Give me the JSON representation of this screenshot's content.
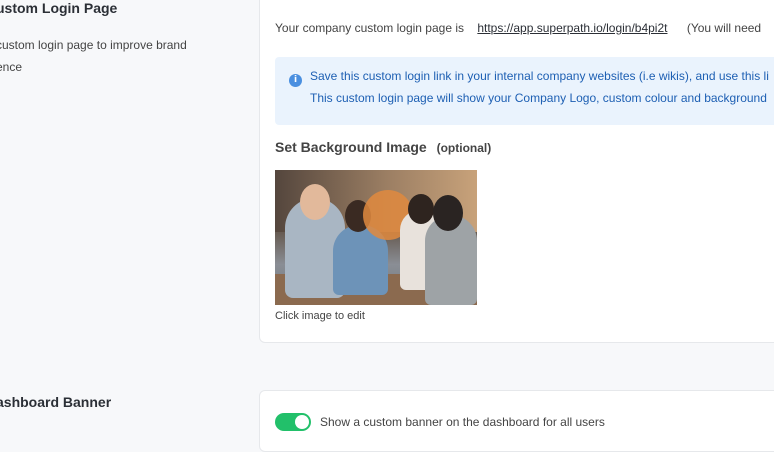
{
  "login_section": {
    "title": "ustom Login Page",
    "description_line1": "custom login page to improve brand",
    "description_line2": "ence",
    "login_text": "Your company custom login page is",
    "login_url": "https://app.superpath.io/login/b4pi2t",
    "login_note": "(You will need",
    "info_line1": "Save this custom login link in your internal company websites (i.e wikis), and use this li",
    "info_line2": "This custom login page will show your Company Logo, custom colour and background",
    "bg_title": "Set Background Image",
    "bg_optional": "(optional)",
    "click_to_edit": "Click image to edit"
  },
  "banner_section": {
    "title": "ashboard Banner",
    "toggle_label": "Show a custom banner on the dashboard for all users",
    "toggle_on": true
  },
  "colors": {
    "accent_green": "#22c06a",
    "info_blue": "#1d5fb3",
    "info_bg": "#eaf3fd"
  },
  "icons": {
    "info": "info-circle-icon"
  }
}
